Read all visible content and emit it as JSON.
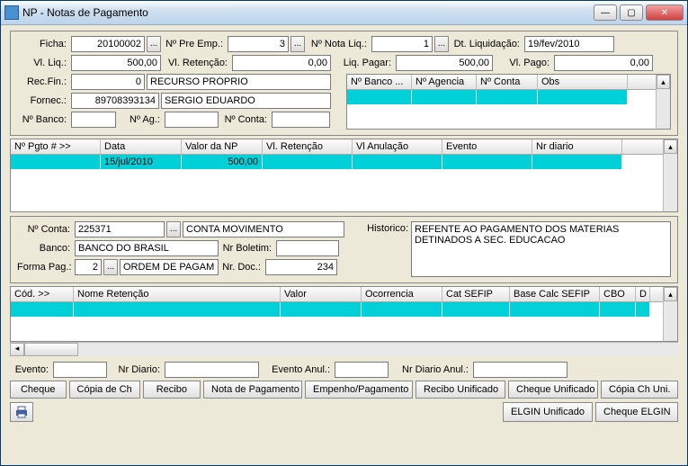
{
  "window": {
    "title": "NP - Notas de Pagamento"
  },
  "top": {
    "ficha_label": "Ficha:",
    "ficha": "20100002",
    "preemp_label": "Nº Pre Emp.:",
    "preemp": "3",
    "notaliq_label": "Nº Nota Liq.:",
    "notaliq": "1",
    "dtliq_label": "Dt. Liquidação:",
    "dtliq": "19/fev/2010",
    "vlliq_label": "Vl. Liq.:",
    "vlliq": "500,00",
    "vlret_label": "Vl. Retenção:",
    "vlret": "0,00",
    "liqpag_label": "Liq. Pagar:",
    "liqpag": "500,00",
    "vlpago_label": "Vl. Pago:",
    "vlpago": "0,00",
    "recfin_label": "Rec.Fin.:",
    "recfin": "0",
    "recfin_desc": "RECURSO PRÓPRIO",
    "fornec_label": "Fornec.:",
    "fornec": "89708393134",
    "fornec_desc": "SERGIO EDUARDO",
    "nbanco_label": "Nº Banco:",
    "nbanco": "",
    "nag_label": "Nº Ag.:",
    "nag": "",
    "nconta_label": "Nº Conta:",
    "nconta": ""
  },
  "bank_grid": {
    "headers": [
      "Nº Banco ...",
      "Nº Agencia",
      "Nº Conta",
      "Obs"
    ]
  },
  "pgto_grid": {
    "headers": [
      "Nº Pgto # >>",
      "Data",
      "Valor da NP",
      "Vl. Retenção",
      "Vl Anulação",
      "Evento",
      "Nr diario"
    ],
    "row": {
      "data": "15/jul/2010",
      "valor": "500,00"
    }
  },
  "mid": {
    "nconta_label": "Nº Conta:",
    "nconta": "225371",
    "nconta_desc": "CONTA MOVIMENTO",
    "hist_label": "Historico:",
    "historico": "REFENTE AO PAGAMENTO DOS MATERIAS DETINADOS A SEC. EDUCACAO",
    "banco_label": "Banco:",
    "banco": "BANCO DO BRASIL",
    "nrbol_label": "Nr Boletim:",
    "nrbol": "",
    "forma_label": "Forma Pag.:",
    "forma": "2",
    "forma_desc": "ORDEM DE PAGAME",
    "nrdoc_label": "Nr. Doc.:",
    "nrdoc": "234"
  },
  "ret_grid": {
    "headers": [
      "Cód. >>",
      "Nome Retenção",
      "Valor",
      "Ocorrencia",
      "Cat SEFIP",
      "Base Calc SEFIP",
      "CBO",
      "D"
    ]
  },
  "evt": {
    "evento_label": "Evento:",
    "evento": "",
    "nrdiario_label": "Nr Diario:",
    "nrdiario": "",
    "evanul_label": "Evento Anul.:",
    "evanul": "",
    "nrdanul_label": "Nr Diario Anul.:",
    "nrdanul": ""
  },
  "buttons": {
    "cheque": "Cheque",
    "copiach": "Cópia de Ch",
    "recibo": "Recibo",
    "notapag": "Nota de Pagamento",
    "emppag": "Empenho/Pagamento",
    "recuni": "Recibo Unificado",
    "chequni": "Cheque Unificado",
    "copiachuni": "Cópia Ch Uni.",
    "elginuni": "ELGIN Unificado",
    "cheqelgin": "Cheque ELGIN"
  }
}
